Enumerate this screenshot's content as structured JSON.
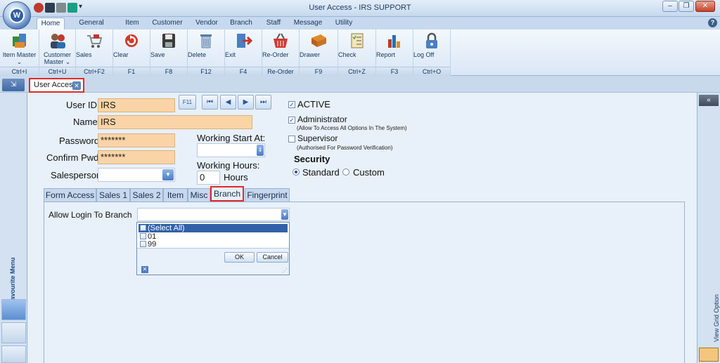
{
  "window": {
    "title": "User Access - IRS SUPPORT"
  },
  "ribbon_tabs": [
    {
      "label": "Home"
    },
    {
      "label": "General Setup"
    },
    {
      "label": "Item"
    },
    {
      "label": "Customer"
    },
    {
      "label": "Vendor"
    },
    {
      "label": "Branch"
    },
    {
      "label": "Staff"
    },
    {
      "label": "Message"
    },
    {
      "label": "Utility"
    }
  ],
  "ribbon_buttons": [
    {
      "label": "Item Master ⌄",
      "shortcut": "Ctrl+I",
      "icon": "item-master-icon"
    },
    {
      "label": "Customer Master ⌄",
      "shortcut": "Ctrl+U",
      "icon": "customer-master-icon"
    },
    {
      "label": "Sales",
      "shortcut": "Ctrl+F2",
      "icon": "sales-cart-icon"
    },
    {
      "label": "Clear",
      "shortcut": "F1",
      "icon": "clear-icon"
    },
    {
      "label": "Save",
      "shortcut": "F8",
      "icon": "save-icon"
    },
    {
      "label": "Delete",
      "shortcut": "F12",
      "icon": "delete-icon"
    },
    {
      "label": "Exit",
      "shortcut": "F4",
      "icon": "exit-icon"
    },
    {
      "label": "Re-Order",
      "shortcut": "Re-Order",
      "icon": "reorder-basket-icon"
    },
    {
      "label": "Drawer",
      "shortcut": "F9",
      "icon": "drawer-icon"
    },
    {
      "label": "Check",
      "shortcut": "Ctrl+Z",
      "icon": "check-list-icon"
    },
    {
      "label": "Report",
      "shortcut": "F3",
      "icon": "report-chart-icon"
    },
    {
      "label": "Log Off",
      "shortcut": "Ctrl+O",
      "icon": "lock-icon"
    }
  ],
  "doc_tab": {
    "label": "User Access"
  },
  "sidebar": {
    "left_label": "My Favourite Menu",
    "right_label": "View Grid Option",
    "right_toggle": "«"
  },
  "form": {
    "user_id_label": "User ID",
    "user_id_value": "IRS",
    "name_label": "Name",
    "name_value": "IRS",
    "password_label": "Password",
    "password_value": "*******",
    "confirm_label": "Confirm Pwd",
    "confirm_value": "*******",
    "salesperson_label": "Salesperson",
    "salesperson_value": "",
    "f11_label": "F11",
    "working_start_label": "Working Start At:",
    "working_start_value": "",
    "working_hours_label": "Working Hours:",
    "working_hours_value": "0",
    "hours_unit": "Hours",
    "active_label": "ACTIVE",
    "admin_label": "Administrator",
    "admin_note": "(Allow To Access All Options In The System)",
    "supervisor_label": "Supervisor",
    "supervisor_note": "(Authorised For Password Verification)",
    "security_label": "Security",
    "security_standard": "Standard",
    "security_custom": "Custom"
  },
  "subtabs": [
    {
      "label": "Form Access"
    },
    {
      "label": "Sales 1"
    },
    {
      "label": "Sales 2"
    },
    {
      "label": "Item"
    },
    {
      "label": "Misc"
    },
    {
      "label": "Branch"
    },
    {
      "label": "Fingerprint"
    }
  ],
  "branch_panel": {
    "allow_login_label": "Allow Login To Branch",
    "options": [
      {
        "label": "(Select All)"
      },
      {
        "label": "01"
      },
      {
        "label": "99"
      }
    ],
    "ok_label": "OK",
    "cancel_label": "Cancel"
  },
  "colors": {
    "required_field": "#fad4a6",
    "highlight": "#e02a2a",
    "selection": "#3261a8"
  }
}
